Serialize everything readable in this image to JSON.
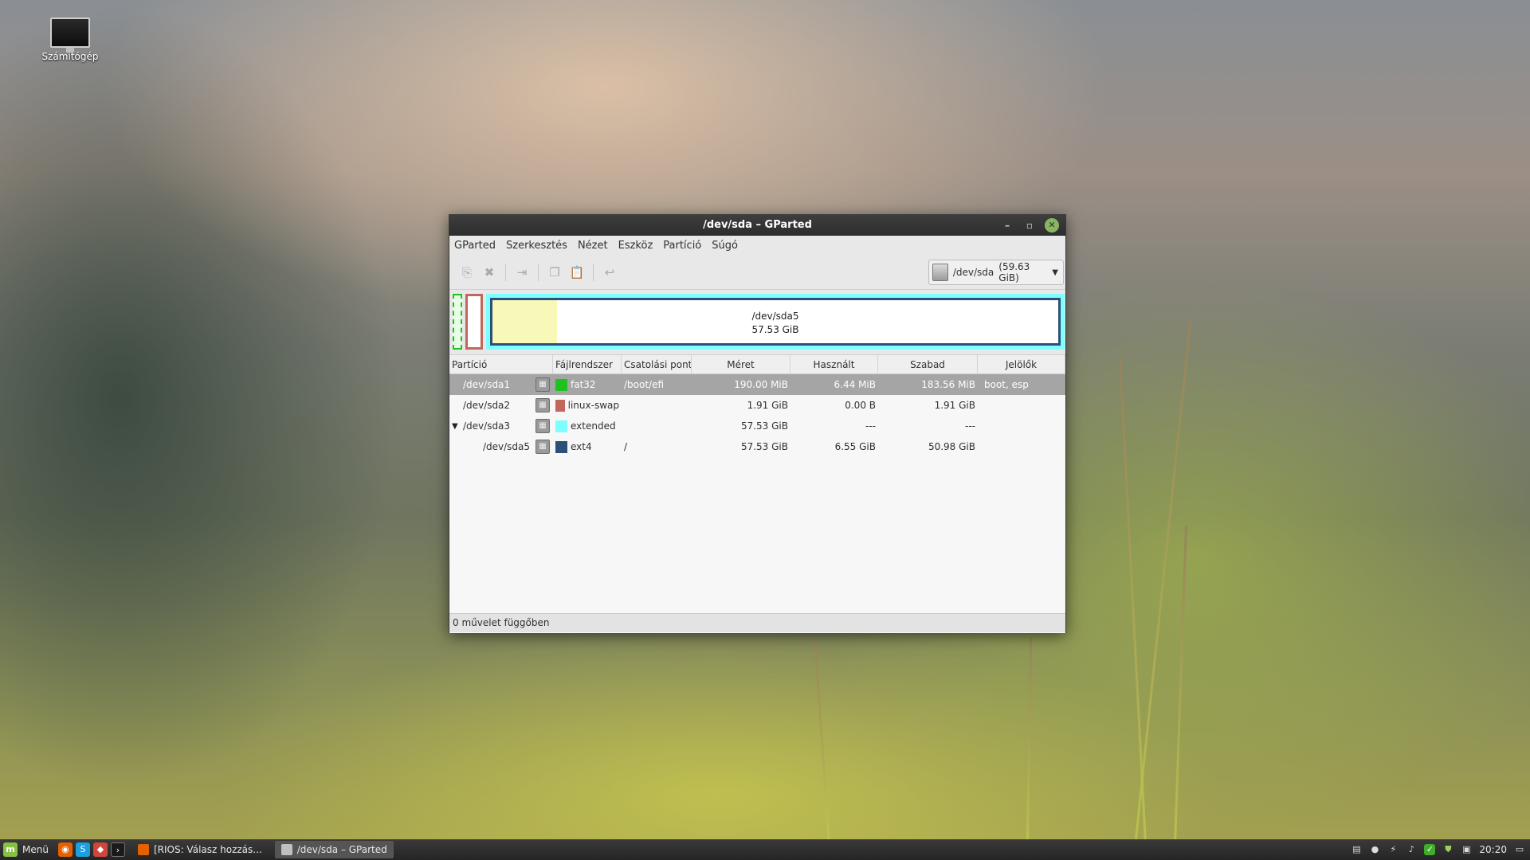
{
  "desktop": {
    "icon_label": "Számítógép"
  },
  "window": {
    "title": "/dev/sda – GParted",
    "menu": [
      "GParted",
      "Szerkesztés",
      "Nézet",
      "Eszköz",
      "Partíció",
      "Súgó"
    ],
    "toolbar": {
      "icons": [
        "new-partition-icon",
        "delete-icon",
        "resize-move-icon",
        "copy-icon",
        "paste-icon",
        "undo-icon"
      ]
    },
    "device_selector": {
      "device": "/dev/sda",
      "size": "(59.63 GiB)"
    },
    "diskmap": {
      "extended_label_name": "/dev/sda5",
      "extended_label_size": "57.53 GiB",
      "sda5_used_fraction": 0.114,
      "colors": {
        "fat32": "#1ec21e",
        "linux_swap": "#c1665a",
        "extended": "#7dffff",
        "ext4": "#2b507a",
        "used": "#f8f8b8"
      }
    },
    "table": {
      "headers": [
        "Partíció",
        "Fájlrendszer",
        "Csatolási pont",
        "Méret",
        "Használt",
        "Szabad",
        "Jelölők"
      ],
      "rows": [
        {
          "partition": "/dev/sda1",
          "fs": "fat32",
          "fs_color": "#1ec21e",
          "mount": "/boot/efi",
          "size": "190.00 MiB",
          "used": "6.44 MiB",
          "free": "183.56 MiB",
          "flags": "boot, esp",
          "selected": true,
          "indent": false,
          "expander": ""
        },
        {
          "partition": "/dev/sda2",
          "fs": "linux-swap",
          "fs_color": "#c1665a",
          "mount": "",
          "size": "1.91 GiB",
          "used": "0.00 B",
          "free": "1.91 GiB",
          "flags": "",
          "selected": false,
          "indent": false,
          "expander": ""
        },
        {
          "partition": "/dev/sda3",
          "fs": "extended",
          "fs_color": "#7dffff",
          "mount": "",
          "size": "57.53 GiB",
          "used": "---",
          "free": "---",
          "flags": "",
          "selected": false,
          "indent": false,
          "expander": "▼"
        },
        {
          "partition": "/dev/sda5",
          "fs": "ext4",
          "fs_color": "#2b507a",
          "mount": "/",
          "size": "57.53 GiB",
          "used": "6.55 GiB",
          "free": "50.98 GiB",
          "flags": "",
          "selected": false,
          "indent": true,
          "expander": ""
        }
      ]
    },
    "status": "0 művelet függőben"
  },
  "taskbar": {
    "menu_label": "Menü",
    "tasks": [
      {
        "label": "[RIOS: Válasz hozzás...",
        "active": false
      },
      {
        "label": "/dev/sda – GParted",
        "active": true
      }
    ],
    "clock": "20:20"
  }
}
